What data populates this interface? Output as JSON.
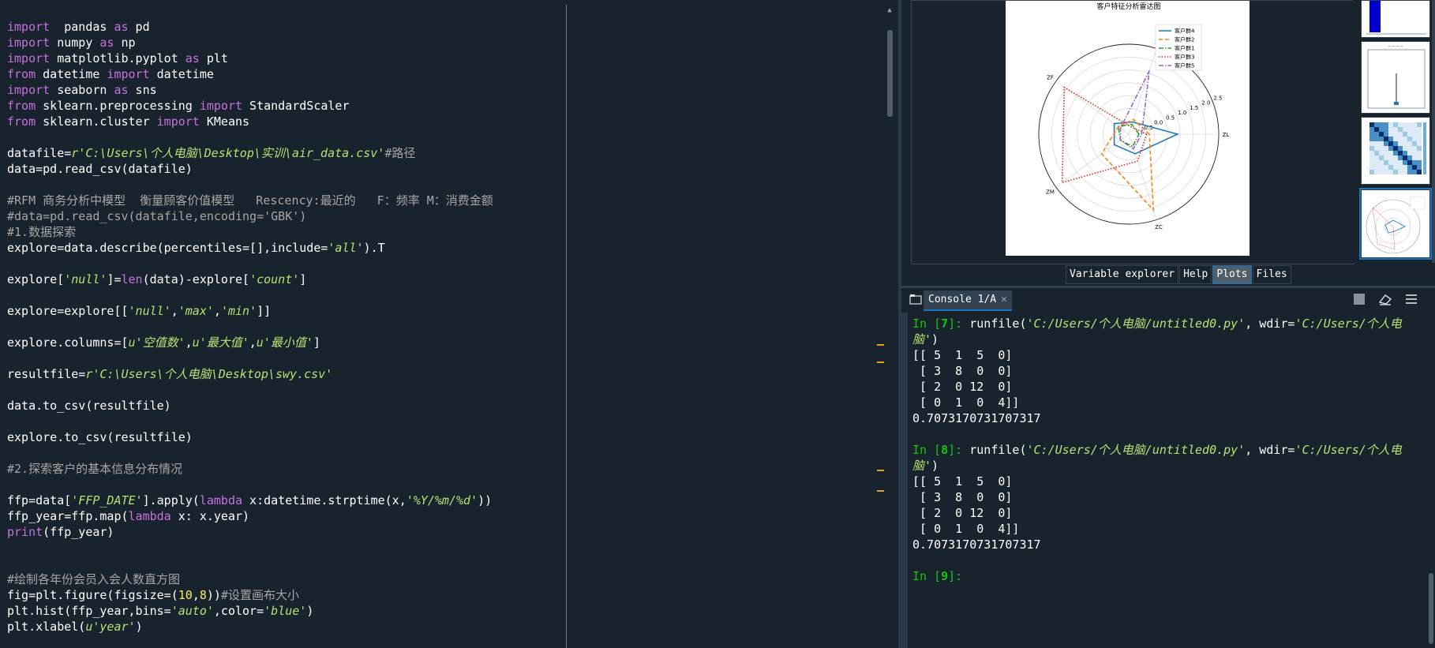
{
  "editor": {
    "lines": [
      [
        {
          "t": "import",
          "c": "kw"
        },
        {
          "t": "  pandas ",
          "c": ""
        },
        {
          "t": "as",
          "c": "kw"
        },
        {
          "t": " pd",
          "c": ""
        }
      ],
      [
        {
          "t": "import",
          "c": "kw"
        },
        {
          "t": " numpy ",
          "c": ""
        },
        {
          "t": "as",
          "c": "kw"
        },
        {
          "t": " np",
          "c": ""
        }
      ],
      [
        {
          "t": "import",
          "c": "kw"
        },
        {
          "t": " matplotlib.pyplot ",
          "c": ""
        },
        {
          "t": "as",
          "c": "kw"
        },
        {
          "t": " plt",
          "c": ""
        }
      ],
      [
        {
          "t": "from",
          "c": "kw"
        },
        {
          "t": " datetime ",
          "c": ""
        },
        {
          "t": "import",
          "c": "kw"
        },
        {
          "t": " datetime",
          "c": ""
        }
      ],
      [
        {
          "t": "import",
          "c": "kw"
        },
        {
          "t": " seaborn ",
          "c": ""
        },
        {
          "t": "as",
          "c": "kw"
        },
        {
          "t": " sns",
          "c": ""
        }
      ],
      [
        {
          "t": "from",
          "c": "kw"
        },
        {
          "t": " sklearn.preprocessing ",
          "c": ""
        },
        {
          "t": "import",
          "c": "kw"
        },
        {
          "t": " StandardScaler",
          "c": ""
        }
      ],
      [
        {
          "t": "from",
          "c": "kw"
        },
        {
          "t": " sklearn.cluster ",
          "c": ""
        },
        {
          "t": "import",
          "c": "kw"
        },
        {
          "t": " KMeans",
          "c": ""
        }
      ],
      [],
      [
        {
          "t": "datafile=",
          "c": ""
        },
        {
          "t": "r'C:\\Users\\个人电脑\\Desktop\\实训\\air_data.csv'",
          "c": "str"
        },
        {
          "t": "#路径",
          "c": "cmt"
        }
      ],
      [
        {
          "t": "data=pd.read_csv(datafile)",
          "c": ""
        }
      ],
      [],
      [
        {
          "t": "#RFM 商务分析中模型  衡量顾客价值模型   Rescency:最近的   F：频率 M：消费金额",
          "c": "cmt"
        }
      ],
      [
        {
          "t": "#data=pd.read_csv(datafile,encoding='GBK')",
          "c": "cmt"
        }
      ],
      [
        {
          "t": "#1.数据探索",
          "c": "cmt"
        }
      ],
      [
        {
          "t": "explore=data.describe(percentiles=[],include=",
          "c": ""
        },
        {
          "t": "'all'",
          "c": "str"
        },
        {
          "t": ").T",
          "c": ""
        }
      ],
      [],
      [
        {
          "t": "explore[",
          "c": ""
        },
        {
          "t": "'null'",
          "c": "str"
        },
        {
          "t": "]=",
          "c": ""
        },
        {
          "t": "len",
          "c": "bi"
        },
        {
          "t": "(data)-explore[",
          "c": ""
        },
        {
          "t": "'count'",
          "c": "str"
        },
        {
          "t": "]",
          "c": ""
        }
      ],
      [],
      [
        {
          "t": "explore=explore[[",
          "c": ""
        },
        {
          "t": "'null'",
          "c": "str"
        },
        {
          "t": ",",
          "c": ""
        },
        {
          "t": "'max'",
          "c": "str"
        },
        {
          "t": ",",
          "c": ""
        },
        {
          "t": "'min'",
          "c": "str"
        },
        {
          "t": "]]",
          "c": ""
        }
      ],
      [],
      [
        {
          "t": "explore.columns=[",
          "c": ""
        },
        {
          "t": "u'空值数'",
          "c": "str"
        },
        {
          "t": ",",
          "c": ""
        },
        {
          "t": "u'最大值'",
          "c": "str"
        },
        {
          "t": ",",
          "c": ""
        },
        {
          "t": "u'最小值'",
          "c": "str"
        },
        {
          "t": "]",
          "c": ""
        }
      ],
      [],
      [
        {
          "t": "resultfile=",
          "c": ""
        },
        {
          "t": "r'C:\\Users\\个人电脑\\Desktop\\swy.csv'",
          "c": "str"
        }
      ],
      [],
      [
        {
          "t": "data.to_csv(resultfile)",
          "c": ""
        }
      ],
      [],
      [
        {
          "t": "explore.to_csv(resultfile)",
          "c": ""
        }
      ],
      [],
      [
        {
          "t": "#2.探索客户的基本信息分布情况",
          "c": "cmt"
        }
      ],
      [],
      [
        {
          "t": "ffp=data[",
          "c": ""
        },
        {
          "t": "'FFP_DATE'",
          "c": "str"
        },
        {
          "t": "].apply(",
          "c": ""
        },
        {
          "t": "lambda",
          "c": "kw"
        },
        {
          "t": " x:datetime.strptime(x,",
          "c": ""
        },
        {
          "t": "'%Y/%m/%d'",
          "c": "str"
        },
        {
          "t": "))",
          "c": ""
        }
      ],
      [
        {
          "t": "ffp_year=ffp.map(",
          "c": ""
        },
        {
          "t": "lambda",
          "c": "kw"
        },
        {
          "t": " x: x.year)",
          "c": ""
        }
      ],
      [
        {
          "t": "print",
          "c": "bi"
        },
        {
          "t": "(ffp_year)",
          "c": ""
        }
      ],
      [],
      [],
      [
        {
          "t": "#绘制各年份会员入会人数直方图",
          "c": "cmt"
        }
      ],
      [
        {
          "t": "fig=plt.figure(figsize=(",
          "c": ""
        },
        {
          "t": "10",
          "c": "num"
        },
        {
          "t": ",",
          "c": ""
        },
        {
          "t": "8",
          "c": "num"
        },
        {
          "t": "))",
          "c": ""
        },
        {
          "t": "#设置画布大小",
          "c": "cmt"
        }
      ],
      [
        {
          "t": "plt.hist(ffp_year,bins=",
          "c": ""
        },
        {
          "t": "'auto'",
          "c": "str"
        },
        {
          "t": ",color=",
          "c": ""
        },
        {
          "t": "'blue'",
          "c": "str"
        },
        {
          "t": ")",
          "c": ""
        }
      ],
      [
        {
          "t": "plt.xlabel(",
          "c": ""
        },
        {
          "t": "u'year'",
          "c": "str"
        },
        {
          "t": ")",
          "c": ""
        }
      ]
    ]
  },
  "plot": {
    "chart_data": {
      "type": "radar",
      "title": "客户特征分析雷达图",
      "axes": [
        "ZL",
        "ZR",
        "ZF",
        "ZM",
        "ZC"
      ],
      "rlabels": [
        "-0.5",
        "0.0",
        "0.5",
        "1.0",
        "1.5",
        "2.0",
        "2.5"
      ],
      "rlim": [
        -1.0,
        2.5
      ],
      "legend_position": "top-right",
      "series": [
        {
          "name": "客户群4",
          "color": "#1f77b4",
          "style": "solid",
          "values": [
            0.9,
            -0.5,
            -0.3,
            -0.3,
            -0.2
          ]
        },
        {
          "name": "客户群2",
          "color": "#ff7f0e",
          "style": "dashed",
          "values": [
            -0.2,
            -0.4,
            -0.5,
            0.3,
            2.1
          ]
        },
        {
          "name": "客户群1",
          "color": "#2ca02c",
          "style": "dashdot",
          "values": [
            -0.6,
            -0.6,
            -0.5,
            -0.6,
            -0.5
          ]
        },
        {
          "name": "客户群3",
          "color": "#d62728",
          "style": "dotted",
          "values": [
            -0.3,
            -0.7,
            2.1,
            2.2,
            0.1
          ]
        },
        {
          "name": "客户群5",
          "color": "#9467bd",
          "style": "dashdot",
          "values": [
            -0.5,
            1.6,
            -0.6,
            -0.6,
            -0.4
          ]
        }
      ]
    }
  },
  "tabs": [
    {
      "label": "Variable explorer",
      "active": false
    },
    {
      "label": "Help",
      "active": false
    },
    {
      "label": "Plots",
      "active": true
    },
    {
      "label": "Files",
      "active": false
    }
  ],
  "console_tab": {
    "label": "Console 1/A",
    "close": "✕"
  },
  "console": {
    "lines": [
      [
        {
          "t": "In [",
          "c": "prompt"
        },
        {
          "t": "7",
          "c": "num"
        },
        {
          "t": "]: ",
          "c": "prompt"
        },
        {
          "t": "runfile(",
          "c": ""
        },
        {
          "t": "'C:/Users/个人电脑/untitled0.py'",
          "c": "str"
        },
        {
          "t": ", wdir=",
          "c": ""
        },
        {
          "t": "'C:/Users/个人电",
          "c": "str"
        }
      ],
      [
        {
          "t": "脑'",
          "c": "str"
        },
        {
          "t": ")",
          "c": ""
        }
      ],
      [
        {
          "t": "[[ 5  1  5  0]",
          "c": ""
        }
      ],
      [
        {
          "t": " [ 3  8  0  0]",
          "c": ""
        }
      ],
      [
        {
          "t": " [ 2  0 12  0]",
          "c": ""
        }
      ],
      [
        {
          "t": " [ 0  1  0  4]]",
          "c": ""
        }
      ],
      [
        {
          "t": "0.7073170731707317",
          "c": ""
        }
      ],
      [],
      [
        {
          "t": "In [",
          "c": "prompt"
        },
        {
          "t": "8",
          "c": "num"
        },
        {
          "t": "]: ",
          "c": "prompt"
        },
        {
          "t": "runfile(",
          "c": ""
        },
        {
          "t": "'C:/Users/个人电脑/untitled0.py'",
          "c": "str"
        },
        {
          "t": ", wdir=",
          "c": ""
        },
        {
          "t": "'C:/Users/个人电",
          "c": "str"
        }
      ],
      [
        {
          "t": "脑'",
          "c": "str"
        },
        {
          "t": ")",
          "c": ""
        }
      ],
      [
        {
          "t": "[[ 5  1  5  0]",
          "c": ""
        }
      ],
      [
        {
          "t": " [ 3  8  0  0]",
          "c": ""
        }
      ],
      [
        {
          "t": " [ 2  0 12  0]",
          "c": ""
        }
      ],
      [
        {
          "t": " [ 0  1  0  4]]",
          "c": ""
        }
      ],
      [
        {
          "t": "0.7073170731707317",
          "c": ""
        }
      ],
      [],
      [
        {
          "t": "In [",
          "c": "prompt"
        },
        {
          "t": "9",
          "c": "num"
        },
        {
          "t": "]: ",
          "c": "prompt"
        }
      ]
    ]
  }
}
